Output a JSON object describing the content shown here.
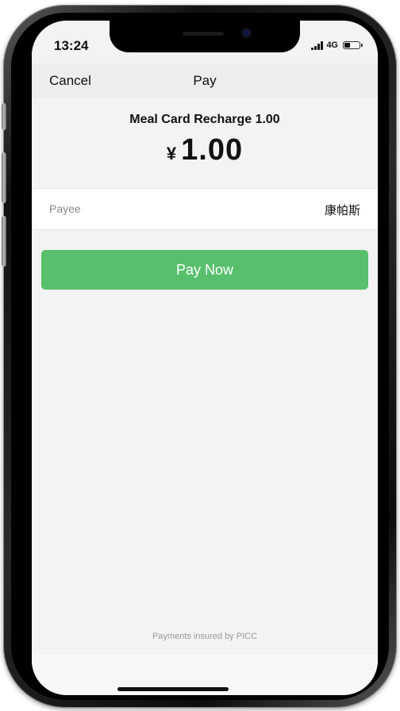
{
  "status_bar": {
    "time": "13:24",
    "network": "4G",
    "battery_level": 0.35
  },
  "nav": {
    "cancel_label": "Cancel",
    "title": "Pay"
  },
  "order": {
    "description": "Meal Card Recharge 1.00",
    "currency_symbol": "¥",
    "amount": "1.00"
  },
  "payee": {
    "label": "Payee",
    "value": "康帕斯"
  },
  "actions": {
    "pay_now_label": "Pay Now"
  },
  "footer": {
    "note": "Payments insured by PICC"
  },
  "colors": {
    "primary_button": "#58c06c",
    "page_background": "#f3f3f3",
    "nav_background": "#ededed"
  }
}
